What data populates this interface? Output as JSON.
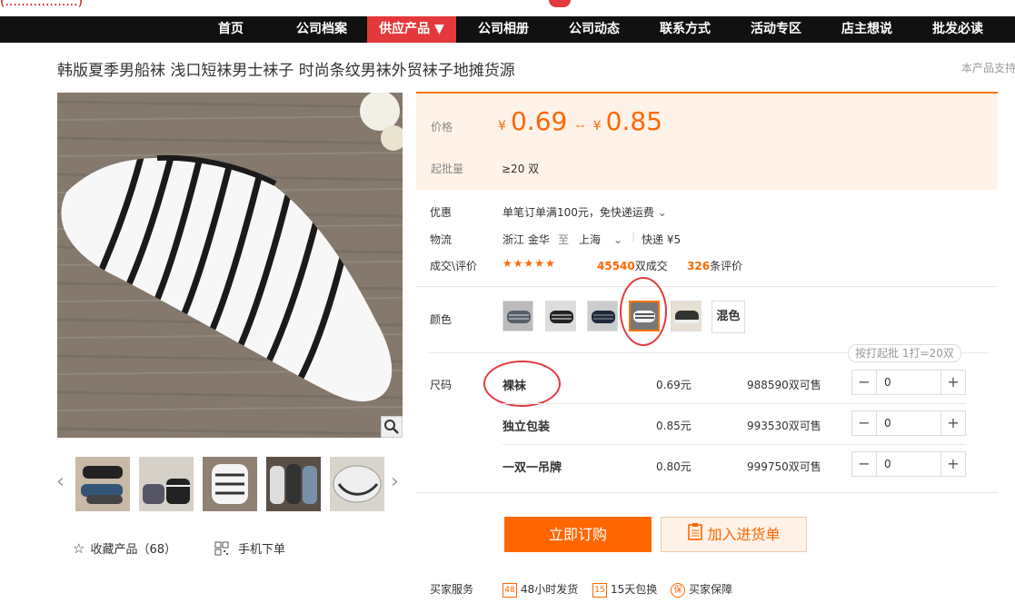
{
  "nav": {
    "items": [
      "首页",
      "公司档案",
      "供应产品 ▼",
      "公司相册",
      "公司动态",
      "联系方式",
      "活动专区",
      "店主想说",
      "批发必读"
    ]
  },
  "product": {
    "title": "韩版夏季男船袜 浅口短袜男士袜子 时尚条纹男袜外贸袜子地摊货源",
    "support_note": "本产品支持"
  },
  "price": {
    "label": "价格",
    "currency": "¥",
    "min": "0.69",
    "separator": "--",
    "max": "0.85",
    "moq_label": "起批量",
    "moq_value": "≥20 双"
  },
  "promo": {
    "label": "优惠",
    "text": "单笔订单满100元，免快递运费"
  },
  "logistics": {
    "label": "物流",
    "from": "浙江 金华",
    "to_word": "至",
    "to": "上海",
    "express": "快递 ¥5"
  },
  "deals": {
    "label": "成交\\评价",
    "stars": "★★★★★",
    "count": "45540",
    "count_suffix": "双成交",
    "reviews": "326",
    "reviews_suffix": "条评价"
  },
  "color": {
    "label": "颜色",
    "mix_label": "混色"
  },
  "batch_tip": "按打起批 1打=20双",
  "size": {
    "label": "尺码",
    "rows": [
      {
        "name": "裸袜",
        "price": "0.69元",
        "stock": "988590双可售",
        "qty": "0"
      },
      {
        "name": "独立包装",
        "price": "0.85元",
        "stock": "993530双可售",
        "qty": "0"
      },
      {
        "name": "一双一吊牌",
        "price": "0.80元",
        "stock": "999750双可售",
        "qty": "0"
      }
    ]
  },
  "buttons": {
    "buy": "立即订购",
    "cart": "加入进货单"
  },
  "left_actions": {
    "favorite": "收藏产品（68）",
    "mobile": "手机下单"
  },
  "services": {
    "label": "买家服务",
    "items": [
      "48小时发货",
      "15天包换",
      "买家保障"
    ]
  },
  "colors": {
    "accent": "#ff6600",
    "nav_bg": "#111111",
    "nav_active": "#e4393c",
    "price_bg": "#fff2e8"
  }
}
